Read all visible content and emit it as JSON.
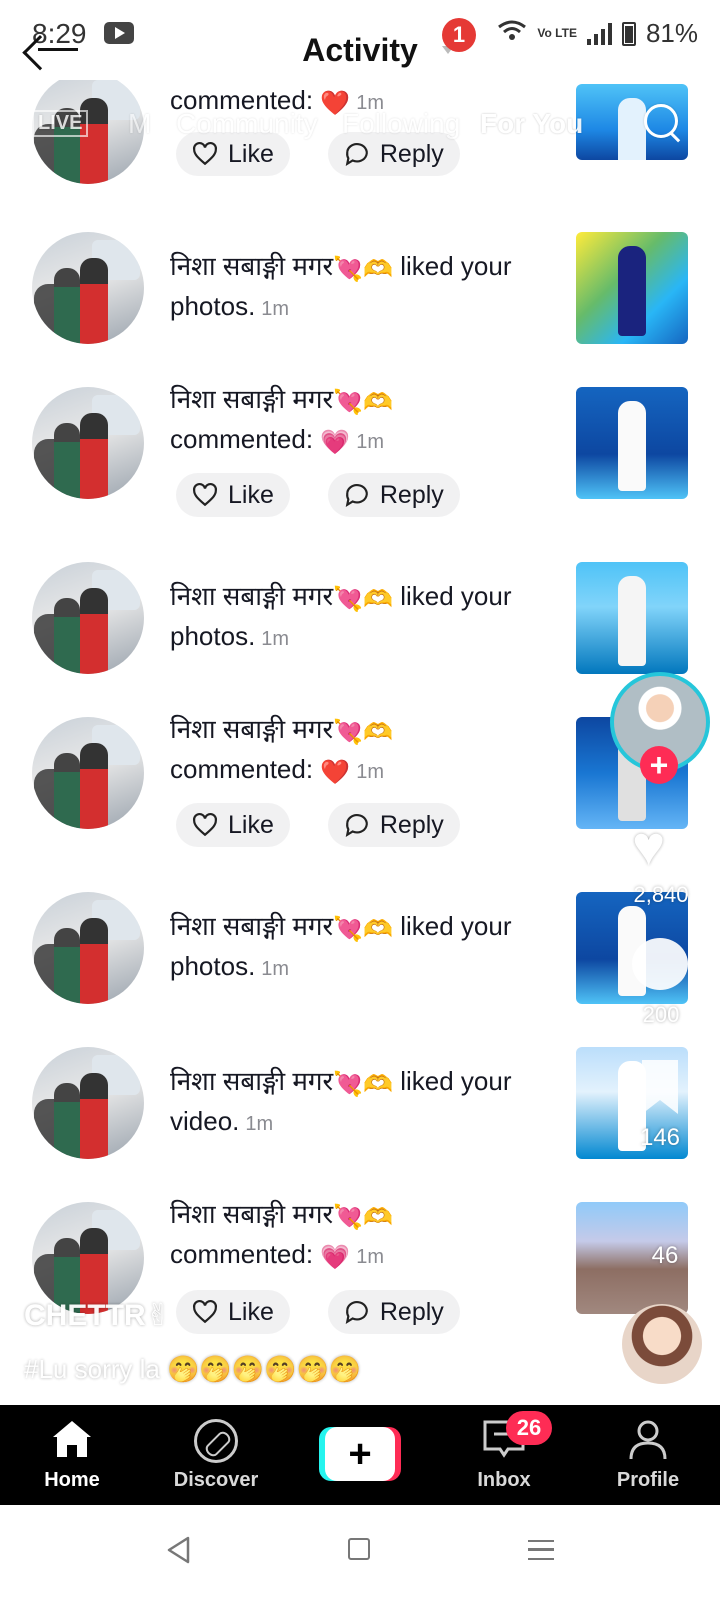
{
  "status_bar": {
    "time": "8:29",
    "volte": "Vo LTE",
    "battery": "81%"
  },
  "header": {
    "title": "Activity",
    "notification_count": "1"
  },
  "overlay": {
    "live": "LIVE",
    "tab_m": "M",
    "tab_community": "Community",
    "tab_following": "Following",
    "tab_for_you": "For You",
    "likes_count": "2,840",
    "comments_count": "200",
    "bookmarks_count": "146",
    "shares_count": "46",
    "caption_user": "CHETTR✌",
    "caption_text": "#Lu sorry la 🤭🤭🤭🤭🤭🤭"
  },
  "activity": {
    "username": "निशा सबाङ्गी मगर",
    "like_label": "Like",
    "reply_label": "Reply",
    "items": [
      {
        "action": "commented:",
        "emoji": "❤️",
        "time": "1m"
      },
      {
        "action": "liked your photos.",
        "time": "1m"
      },
      {
        "action": "commented:",
        "emoji": "💗",
        "time": "1m"
      },
      {
        "action": "liked your photos.",
        "time": "1m"
      },
      {
        "action": "commented:",
        "emoji": "❤️",
        "time": "1m"
      },
      {
        "action": "liked your photos.",
        "time": "1m"
      },
      {
        "action": "liked your video.",
        "time": "1m"
      },
      {
        "action": "commented:",
        "emoji": "💗",
        "time": "1m"
      }
    ]
  },
  "bottom_nav": {
    "home": "Home",
    "discover": "Discover",
    "create": "+",
    "inbox": "Inbox",
    "inbox_badge": "26",
    "profile": "Profile"
  },
  "colors": {
    "accent": "#fe2c55",
    "cyan": "#25f4ee",
    "badge_red": "#e53935"
  }
}
